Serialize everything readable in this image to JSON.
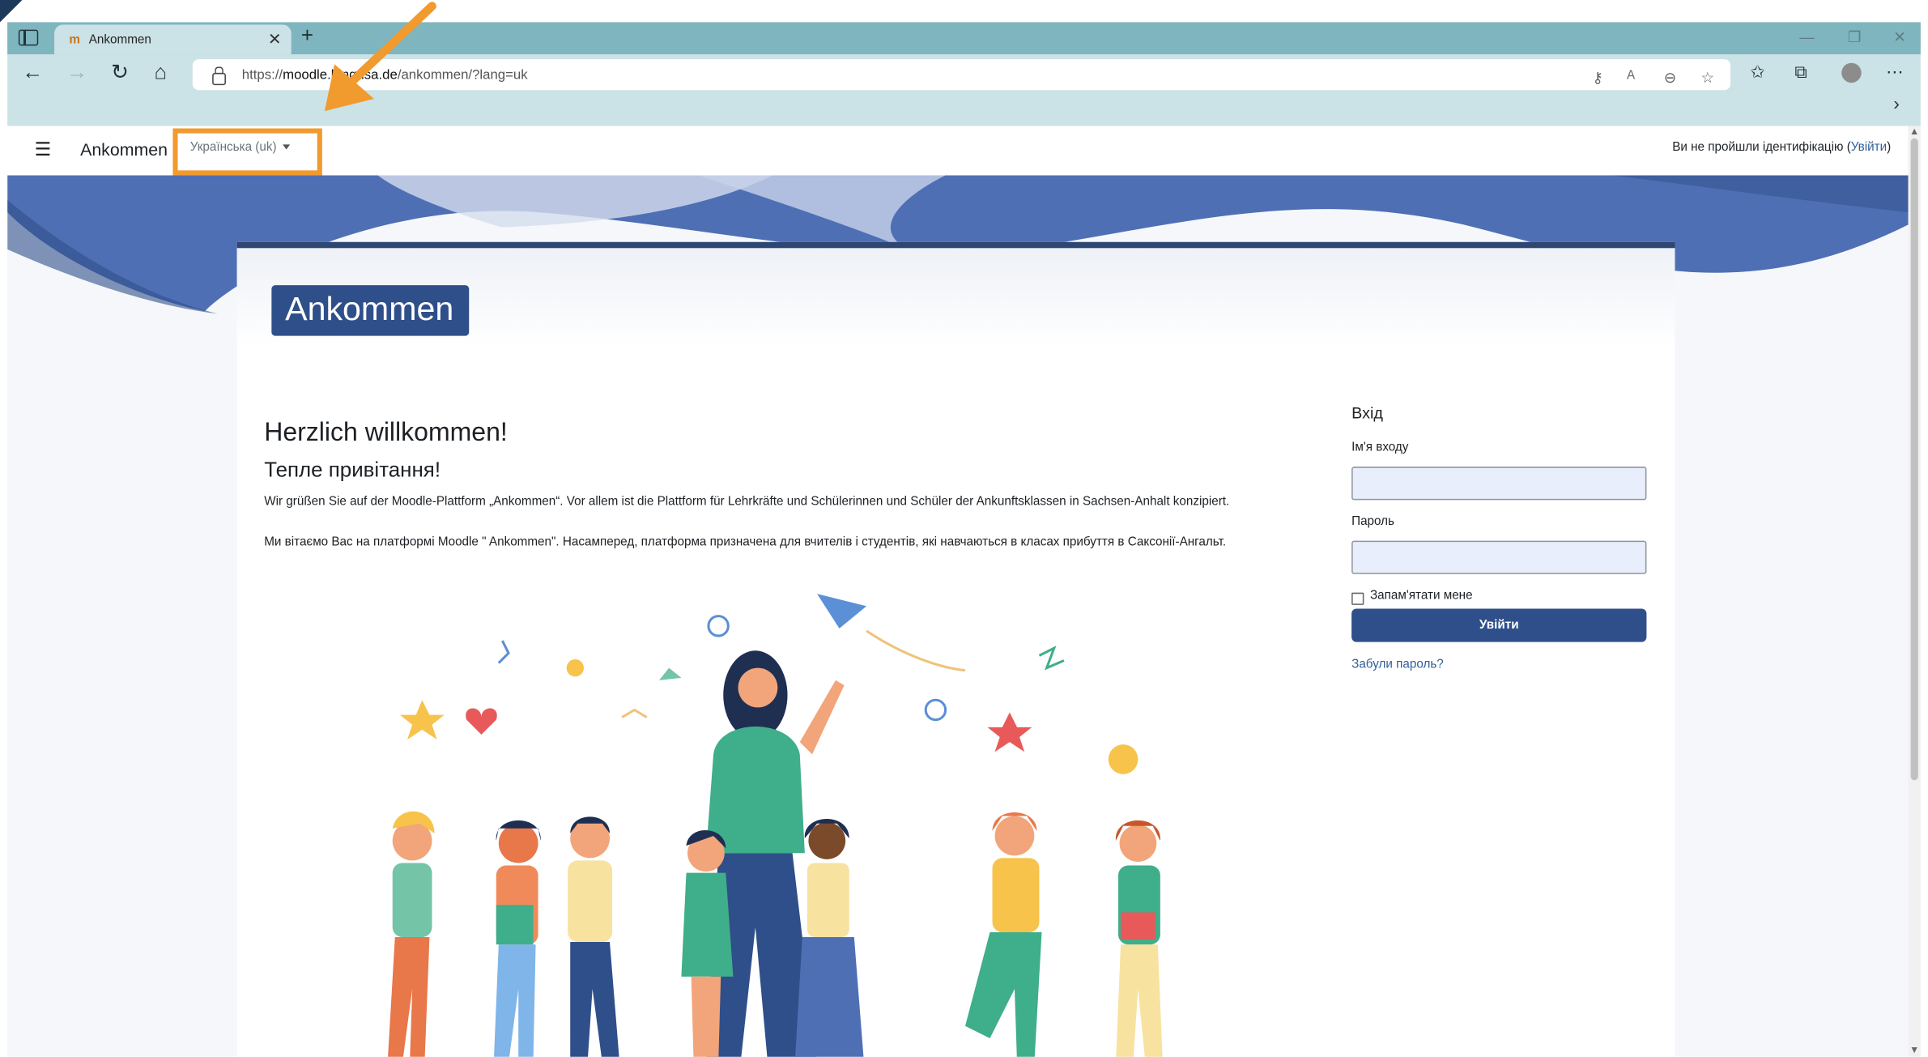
{
  "browser": {
    "tab_title": "Ankommen",
    "tab_favicon": "m",
    "url_prefix": "https://",
    "url_host": "moodle.bi",
    "url_host_hidden": "ng-lsa.de",
    "url_path": "/ankommen/?lang=uk"
  },
  "moodle_nav": {
    "menu_icon": "☰",
    "brand": "Ankommen",
    "language": "Українська (uk)",
    "login_status": "Ви не пройшли ідентифікацію (",
    "login_link": "Увійти",
    "login_status_end": ")"
  },
  "site": {
    "badge": "Ankommen"
  },
  "welcome": {
    "heading_de": "Herzlich willkommen!",
    "heading_uk": "Тепле привітання!",
    "paragraph_de": "Wir grüßen Sie auf der Moodle-Plattform „Ankommen“. Vor allem ist die Plattform für Lehrkräfte und Schülerinnen und Schüler der Ankunftsklassen in Sachsen-Anhalt konzipiert.",
    "paragraph_uk": "Ми вітаємо Вас на платформі Moodle \" Ankommen\". Насамперед, платформа призначена для вчителів і студентів, які навчаються в класах прибуття в Саксонії-Ангальт."
  },
  "login": {
    "heading": "Вхід",
    "username_label": "Ім'я входу",
    "username_value": "",
    "password_label": "Пароль",
    "password_value": "",
    "remember_label": "Запам'ятати мене",
    "submit_label": "Увійти",
    "forgot_link": "Забули пароль?"
  },
  "colors": {
    "brand_blue": "#2f4f8a",
    "highlight_orange": "#f19a2e",
    "tabstrip": "#7fb5bf"
  }
}
